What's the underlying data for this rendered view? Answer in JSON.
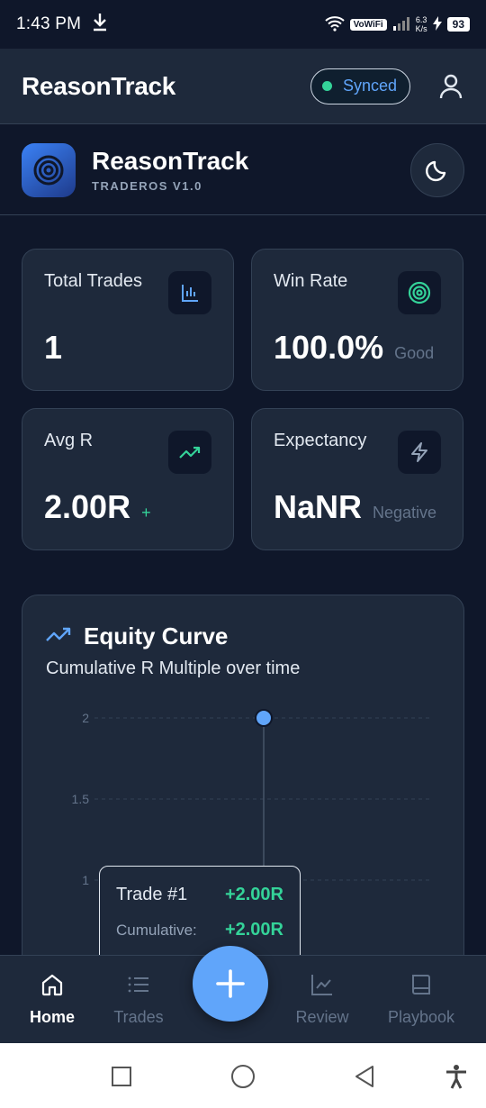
{
  "status_bar": {
    "time": "1:43 PM",
    "volte": "VoWiFi",
    "speed_top": "6.3",
    "speed_bottom": "K/s",
    "battery": "93"
  },
  "header": {
    "title": "ReasonTrack",
    "sync_label": "Synced"
  },
  "brand": {
    "name": "ReasonTrack",
    "version": "TRADEROS V1.0"
  },
  "stats": [
    {
      "label": "Total Trades",
      "value": "1",
      "sub": "",
      "icon": "bar-chart-icon"
    },
    {
      "label": "Win Rate",
      "value": "100.0%",
      "sub": "Good",
      "icon": "target-icon"
    },
    {
      "label": "Avg R",
      "value": "2.00R",
      "sub": "+",
      "icon": "trending-up-icon"
    },
    {
      "label": "Expectancy",
      "value": "NaNR",
      "sub": "Negative",
      "icon": "lightning-icon"
    }
  ],
  "equity": {
    "title": "Equity Curve",
    "subtitle": "Cumulative R Multiple over time",
    "tooltip": {
      "title": "Trade #1",
      "title_value": "+2.00R",
      "label": "Cumulative:",
      "value": "+2.00R"
    }
  },
  "chart_data": {
    "type": "line",
    "title": "Equity Curve",
    "subtitle": "Cumulative R Multiple over time",
    "y_ticks": [
      "2",
      "1.5",
      "1"
    ],
    "series": [
      {
        "x": [
          1
        ],
        "values": [
          2
        ]
      }
    ],
    "grid": true
  },
  "nav": {
    "items": [
      {
        "label": "Home"
      },
      {
        "label": "Trades"
      },
      {
        "label": "Review"
      },
      {
        "label": "Playbook"
      }
    ]
  },
  "colors": {
    "background": "#0f172a",
    "card": "#1e293b",
    "accent": "#60a5fa",
    "positive": "#34d399"
  }
}
